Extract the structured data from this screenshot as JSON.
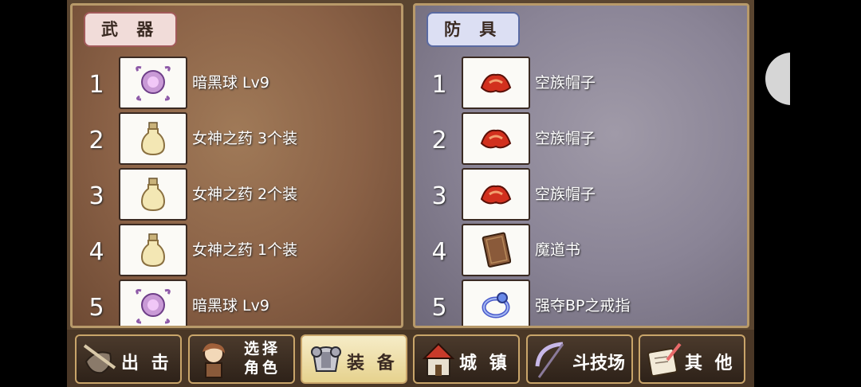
{
  "weapons_panel": {
    "title": "武 器",
    "items": [
      {
        "num": "1",
        "name": "暗黑球 Lv9",
        "icon": "dark-orb-icon"
      },
      {
        "num": "2",
        "name": "女神之药 3个装",
        "icon": "potion-icon"
      },
      {
        "num": "3",
        "name": "女神之药 2个装",
        "icon": "potion-icon"
      },
      {
        "num": "4",
        "name": "女神之药 1个装",
        "icon": "potion-icon"
      },
      {
        "num": "5",
        "name": "暗黑球 Lv9",
        "icon": "dark-orb-icon"
      }
    ]
  },
  "armor_panel": {
    "title": "防 具",
    "items": [
      {
        "num": "1",
        "name": "空族帽子",
        "icon": "red-hat-icon"
      },
      {
        "num": "2",
        "name": "空族帽子",
        "icon": "red-hat-icon"
      },
      {
        "num": "3",
        "name": "空族帽子",
        "icon": "red-hat-icon"
      },
      {
        "num": "4",
        "name": "魔道书",
        "icon": "spellbook-icon"
      },
      {
        "num": "5",
        "name": "强夺BP之戒指",
        "icon": "ring-icon"
      }
    ]
  },
  "nav": {
    "sortie": "出 击",
    "select_char_line1": "选择",
    "select_char_line2": "角色",
    "equip": "装 备",
    "town": "城 镇",
    "arena": "斗技场",
    "other": "其 他"
  }
}
